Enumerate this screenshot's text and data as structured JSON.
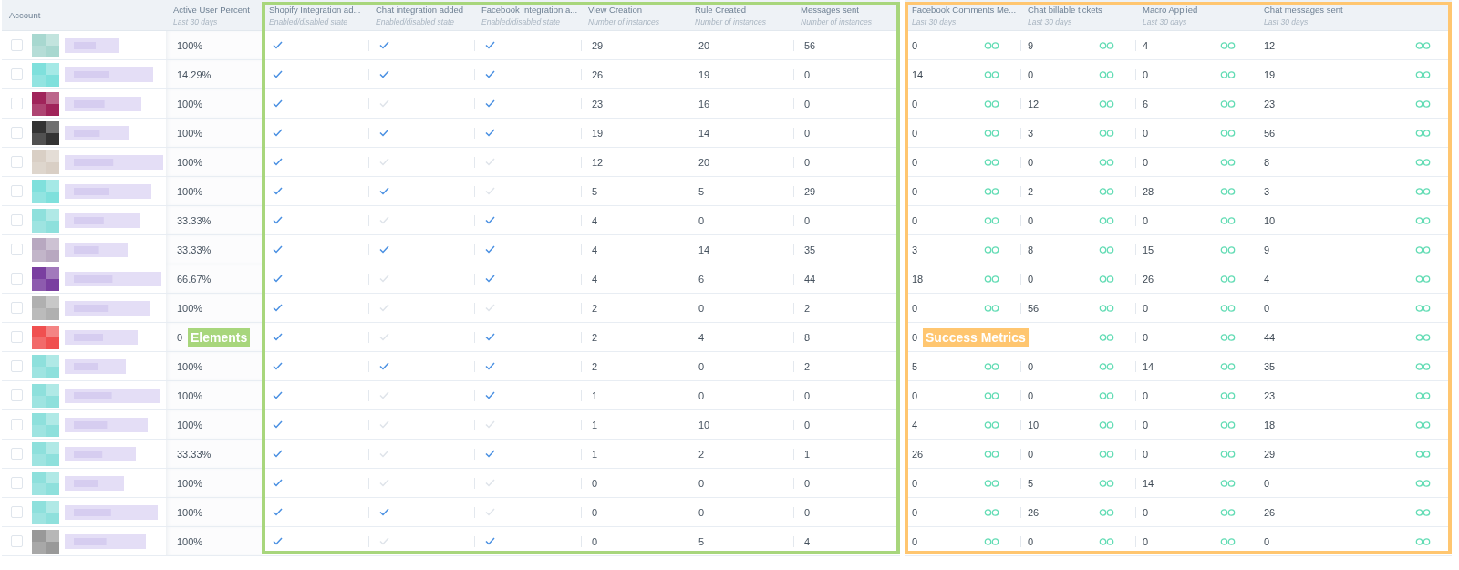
{
  "columns": [
    {
      "title": "Account",
      "kind": "account"
    },
    {
      "title": "Active User Percent",
      "subtitle": "Last 30 days",
      "kind": "text"
    },
    {
      "title": "Shopify Integration ad...",
      "subtitle": "Enabled/disabled state",
      "kind": "check"
    },
    {
      "title": "Chat integration added",
      "subtitle": "Enabled/disabled state",
      "kind": "check"
    },
    {
      "title": "Facebook Integration a...",
      "subtitle": "Enabled/disabled state",
      "kind": "check"
    },
    {
      "title": "View Creation",
      "subtitle": "Number of instances",
      "kind": "number"
    },
    {
      "title": "Rule Created",
      "subtitle": "Number of instances",
      "kind": "number"
    },
    {
      "title": "Messages sent",
      "subtitle": "Number of instances",
      "kind": "number"
    },
    {
      "title": "Facebook Comments Me...",
      "subtitle": "Last 30 days",
      "kind": "metric"
    },
    {
      "title": "Chat billable tickets",
      "subtitle": "Last 30 days",
      "kind": "metric"
    },
    {
      "title": "Macro Applied",
      "subtitle": "Last 30 days",
      "kind": "metric"
    },
    {
      "title": "Chat messages sent",
      "subtitle": "Last 30 days",
      "kind": "metric"
    }
  ],
  "rows": [
    {
      "checked": false,
      "color": "#a8d8d0",
      "cells": [
        "100%",
        true,
        true,
        true,
        "29",
        "20",
        "56",
        "0",
        "9",
        "4",
        "12"
      ]
    },
    {
      "checked": false,
      "color": "#7fe0dc",
      "cells": [
        "14.29%",
        true,
        true,
        true,
        "26",
        "19",
        "0",
        "14",
        "0",
        "0",
        "19"
      ]
    },
    {
      "checked": false,
      "color": "#a0245a",
      "cells": [
        "100%",
        true,
        false,
        true,
        "23",
        "16",
        "0",
        "0",
        "12",
        "6",
        "23"
      ]
    },
    {
      "checked": false,
      "color": "#333333",
      "cells": [
        "100%",
        true,
        true,
        true,
        "19",
        "14",
        "0",
        "0",
        "3",
        "0",
        "56"
      ]
    },
    {
      "checked": false,
      "color": "#d9cfc5",
      "cells": [
        "100%",
        true,
        false,
        false,
        "12",
        "20",
        "0",
        "0",
        "0",
        "0",
        "8"
      ]
    },
    {
      "checked": false,
      "color": "#7fe0dc",
      "cells": [
        "100%",
        true,
        true,
        false,
        "5",
        "5",
        "29",
        "0",
        "2",
        "28",
        "3"
      ]
    },
    {
      "checked": false,
      "color": "#8ee0dc",
      "cells": [
        "33.33%",
        true,
        false,
        true,
        "4",
        "0",
        "0",
        "0",
        "0",
        "0",
        "10"
      ]
    },
    {
      "checked": false,
      "color": "#b8a8c0",
      "cells": [
        "33.33%",
        true,
        true,
        true,
        "4",
        "14",
        "35",
        "3",
        "8",
        "15",
        "9"
      ]
    },
    {
      "checked": false,
      "color": "#7a3fa0",
      "cells": [
        "66.67%",
        true,
        false,
        true,
        "4",
        "6",
        "44",
        "18",
        "0",
        "26",
        "4"
      ]
    },
    {
      "checked": false,
      "color": "#b0b0b0",
      "cells": [
        "100%",
        true,
        false,
        false,
        "2",
        "0",
        "2",
        "0",
        "56",
        "0",
        "0"
      ]
    },
    {
      "checked": false,
      "color": "#f05050",
      "cells": [
        "0",
        true,
        false,
        true,
        "2",
        "4",
        "8",
        "0",
        null,
        "0",
        "44"
      ]
    },
    {
      "checked": false,
      "color": "#8ee0dc",
      "cells": [
        "100%",
        true,
        true,
        true,
        "2",
        "0",
        "2",
        "5",
        "0",
        "14",
        "35"
      ]
    },
    {
      "checked": false,
      "color": "#8ee0dc",
      "cells": [
        "100%",
        true,
        false,
        true,
        "1",
        "0",
        "0",
        "0",
        "0",
        "0",
        "23"
      ]
    },
    {
      "checked": false,
      "color": "#8ee0dc",
      "cells": [
        "100%",
        true,
        false,
        false,
        "1",
        "10",
        "0",
        "4",
        "10",
        "0",
        "18"
      ]
    },
    {
      "checked": false,
      "color": "#8ee0dc",
      "cells": [
        "33.33%",
        true,
        false,
        true,
        "1",
        "2",
        "1",
        "26",
        "0",
        "0",
        "29"
      ]
    },
    {
      "checked": false,
      "color": "#8ee0dc",
      "cells": [
        "100%",
        true,
        false,
        false,
        "0",
        "0",
        "0",
        "0",
        "5",
        "14",
        "0"
      ]
    },
    {
      "checked": false,
      "color": "#8ee0dc",
      "cells": [
        "100%",
        true,
        true,
        false,
        "0",
        "0",
        "0",
        "0",
        "26",
        "0",
        "26"
      ]
    },
    {
      "checked": false,
      "color": "#999999",
      "cells": [
        "100%",
        true,
        false,
        true,
        "0",
        "5",
        "4",
        "0",
        "0",
        "0",
        "0"
      ]
    }
  ],
  "groups": [
    {
      "label": "Elements",
      "kind": "elements",
      "color": "#a8d67c"
    },
    {
      "label": "Success Metrics",
      "kind": "metrics",
      "color": "#ffc670"
    }
  ]
}
